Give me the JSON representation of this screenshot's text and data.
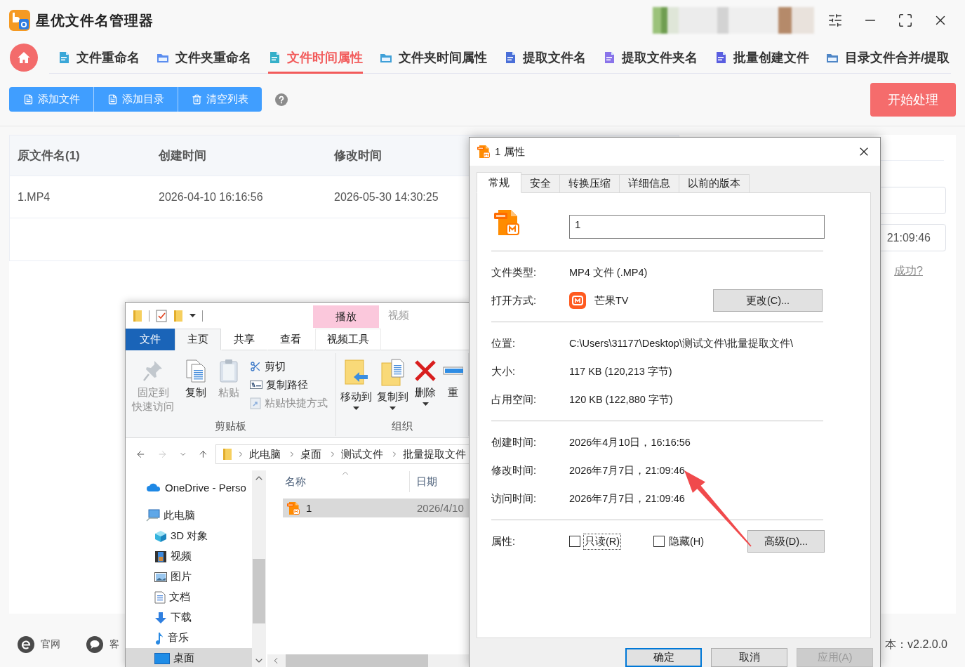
{
  "app": {
    "title": "星优文件名管理器",
    "nav_tabs": [
      {
        "label": "文件重命名",
        "selected": false
      },
      {
        "label": "文件夹重命名",
        "selected": false
      },
      {
        "label": "文件时间属性",
        "selected": true
      },
      {
        "label": "文件夹时间属性",
        "selected": false
      },
      {
        "label": "提取文件名",
        "selected": false
      },
      {
        "label": "提取文件夹名",
        "selected": false
      },
      {
        "label": "批量创建文件",
        "selected": false
      },
      {
        "label": "目录文件合并/提取",
        "selected": false
      }
    ],
    "toolbar_buttons": [
      "添加文件",
      "添加目录",
      "清空列表"
    ],
    "start_button": "开始处理",
    "table": {
      "columns": [
        "原文件名(1)",
        "创建时间",
        "修改时间"
      ],
      "rows": [
        [
          "1.MP4",
          "2026-04-10 16:16:56",
          "2026-05-30 14:30:25"
        ]
      ]
    },
    "side_panel": {
      "time_field": "21:09:46",
      "link": "成功?"
    },
    "footer": {
      "links": [
        "官网",
        "客"
      ],
      "version": "本：v2.2.0.0"
    }
  },
  "explorer": {
    "title": "视频",
    "contextual_header": "播放",
    "ribbon_tabs": [
      {
        "label": "文件",
        "kind": "file",
        "selected": false
      },
      {
        "label": "主页",
        "kind": "tab",
        "selected": true
      },
      {
        "label": "共享",
        "kind": "tab",
        "selected": false
      },
      {
        "label": "查看",
        "kind": "tab",
        "selected": false
      },
      {
        "label": "视频工具",
        "kind": "contextual",
        "selected": false
      }
    ],
    "ribbon_groups": [
      {
        "label": "剪贴板",
        "commands": [
          {
            "label_lines": [
              "固定到",
              "快速访问"
            ],
            "kind": "large",
            "disabled": true,
            "dropdown": false
          },
          {
            "label_lines": [
              "复制"
            ],
            "kind": "large",
            "disabled": false,
            "dropdown": false
          },
          {
            "label_lines": [
              "粘贴"
            ],
            "kind": "large",
            "disabled": true,
            "dropdown": false
          },
          {
            "label_lines": [
              "剪切"
            ],
            "kind": "small",
            "disabled": false,
            "dropdown": false
          },
          {
            "label_lines": [
              "复制路径"
            ],
            "kind": "small",
            "disabled": false,
            "dropdown": false
          },
          {
            "label_lines": [
              "粘贴快捷方式"
            ],
            "kind": "small",
            "disabled": true,
            "dropdown": false
          }
        ]
      },
      {
        "label": "组织",
        "commands": [
          {
            "label_lines": [
              "移动到"
            ],
            "kind": "large",
            "disabled": false,
            "dropdown": true
          },
          {
            "label_lines": [
              "复制到"
            ],
            "kind": "large",
            "disabled": false,
            "dropdown": true
          },
          {
            "label_lines": [
              "删除"
            ],
            "kind": "large",
            "disabled": false,
            "dropdown": true
          },
          {
            "label_lines": [
              "重"
            ],
            "kind": "large",
            "disabled": false,
            "dropdown": false
          }
        ]
      }
    ],
    "nav_buttons": [
      {
        "kind": "back",
        "disabled": false
      },
      {
        "kind": "forward",
        "disabled": true
      },
      {
        "kind": "recent",
        "disabled": false
      },
      {
        "kind": "up",
        "disabled": false
      }
    ],
    "breadcrumbs": [
      "此电脑",
      "桌面",
      "测试文件",
      "批量提取文件"
    ],
    "nav_pane": [
      {
        "label": "OneDrive - Perso",
        "selected": false
      },
      {
        "label": "此电脑",
        "selected": false,
        "children": [
          {
            "label": "3D 对象",
            "selected": false
          },
          {
            "label": "视频",
            "selected": false
          },
          {
            "label": "图片",
            "selected": false
          },
          {
            "label": "文档",
            "selected": false
          },
          {
            "label": "下载",
            "selected": false
          },
          {
            "label": "音乐",
            "selected": false
          },
          {
            "label": "桌面",
            "selected": true
          }
        ]
      }
    ],
    "file_list": {
      "columns": [
        "名称",
        "日期"
      ],
      "rows": [
        {
          "name": "1",
          "date": "2026/4/10",
          "selected": true
        }
      ]
    }
  },
  "properties_dialog": {
    "title": "1 属性",
    "tabs": [
      {
        "label": "常规",
        "selected": true
      },
      {
        "label": "安全",
        "selected": false
      },
      {
        "label": "转换压缩",
        "selected": false
      },
      {
        "label": "详细信息",
        "selected": false
      },
      {
        "label": "以前的版本",
        "selected": false
      }
    ],
    "file_name": "1",
    "sections": [
      [
        {
          "kind": "text",
          "label": "文件类型:",
          "value": "MP4 文件 (.MP4)"
        },
        {
          "kind": "app",
          "label": "打开方式:",
          "value": "芒果TV",
          "button": "更改(C)..."
        }
      ],
      [
        {
          "kind": "text",
          "label": "位置:",
          "value": "C:\\Users\\31177\\Desktop\\测试文件\\批量提取文件\\"
        },
        {
          "kind": "text",
          "label": "大小:",
          "value": "117 KB (120,213 字节)"
        },
        {
          "kind": "text",
          "label": "占用空间:",
          "value": "120 KB (122,880 字节)"
        }
      ],
      [
        {
          "kind": "text",
          "label": "创建时间:",
          "value": "2026年4月10日，16:16:56"
        },
        {
          "kind": "text",
          "label": "修改时间:",
          "value": "2026年7月7日，21:09:46"
        },
        {
          "kind": "text",
          "label": "访问时间:",
          "value": "2026年7月7日，21:09:46"
        }
      ]
    ],
    "attributes": {
      "label": "属性:",
      "checkboxes": [
        {
          "label": "只读(R)",
          "checked": false,
          "focused": true
        },
        {
          "label": "隐藏(H)",
          "checked": false,
          "focused": false
        }
      ],
      "button": "高级(D)..."
    },
    "buttons": [
      {
        "label": "确定",
        "default": true,
        "disabled": false
      },
      {
        "label": "取消",
        "default": false,
        "disabled": false
      },
      {
        "label": "应用(A)",
        "default": false,
        "disabled": true
      }
    ]
  }
}
